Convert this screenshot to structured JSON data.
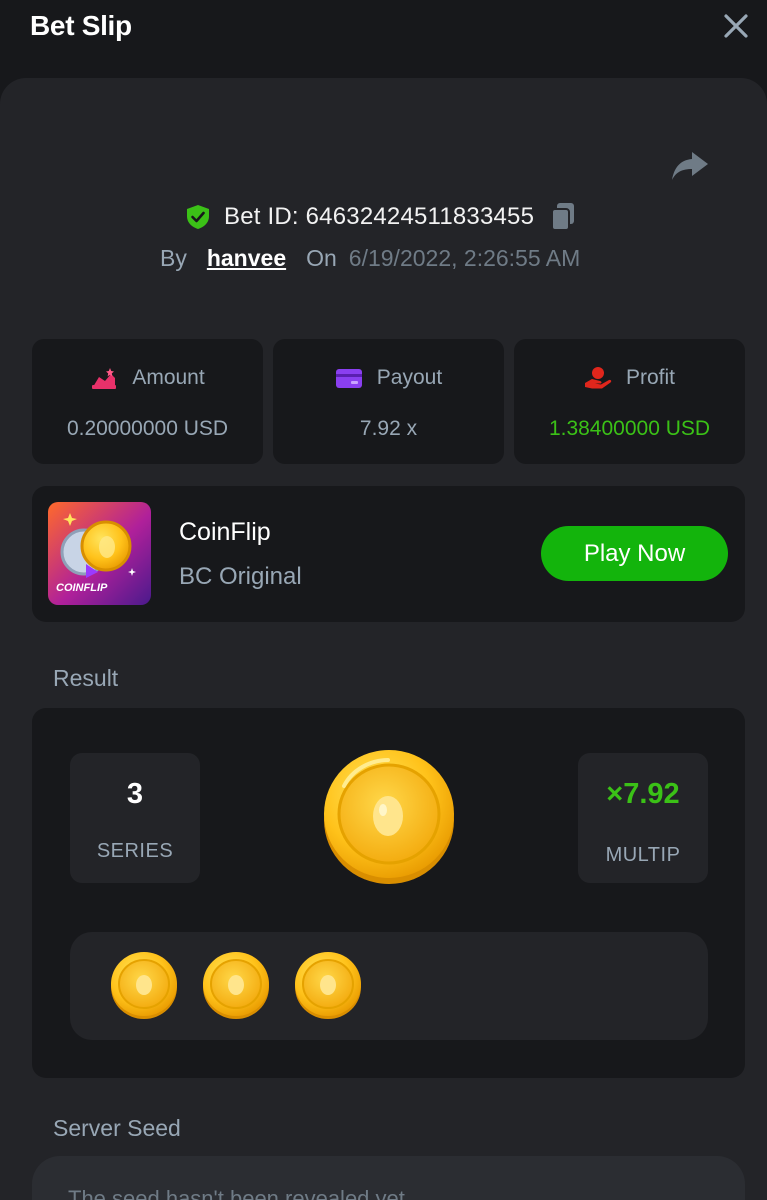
{
  "header": {
    "title": "Bet Slip"
  },
  "bet": {
    "id_text": "Bet ID: 64632424511833455",
    "by_label": "By",
    "username": "hanvee",
    "on_label": "On",
    "date": "6/19/2022, 2:26:55 AM"
  },
  "stats": [
    {
      "label": "Amount",
      "value": "0.20000000 USD",
      "icon": "amount-icon",
      "color": "#e8316a"
    },
    {
      "label": "Payout",
      "value": "7.92 x",
      "icon": "payout-card-icon",
      "color": "#8a3ff0"
    },
    {
      "label": "Profit",
      "value": "1.38400000 USD",
      "icon": "profit-hand-icon",
      "color": "#e0261c"
    }
  ],
  "game": {
    "name": "CoinFlip",
    "subtitle": "BC Original",
    "thumb_label": "COINFLIP",
    "play_label": "Play Now"
  },
  "result": {
    "label": "Result",
    "series_value": "3",
    "series_label": "SERIES",
    "multiplier_value": "×7.92",
    "multiplier_label": "MULTIP",
    "coins": [
      "gold-coin-icon",
      "gold-coin-icon",
      "gold-coin-icon"
    ]
  },
  "server_seed": {
    "label": "Server Seed",
    "text": "The seed hasn't been revealed yet."
  },
  "colors": {
    "accent_green": "#13b40c",
    "profit_green": "#3bc117",
    "muted": "#98a7b5",
    "panel": "#232428",
    "card": "#17181b"
  }
}
